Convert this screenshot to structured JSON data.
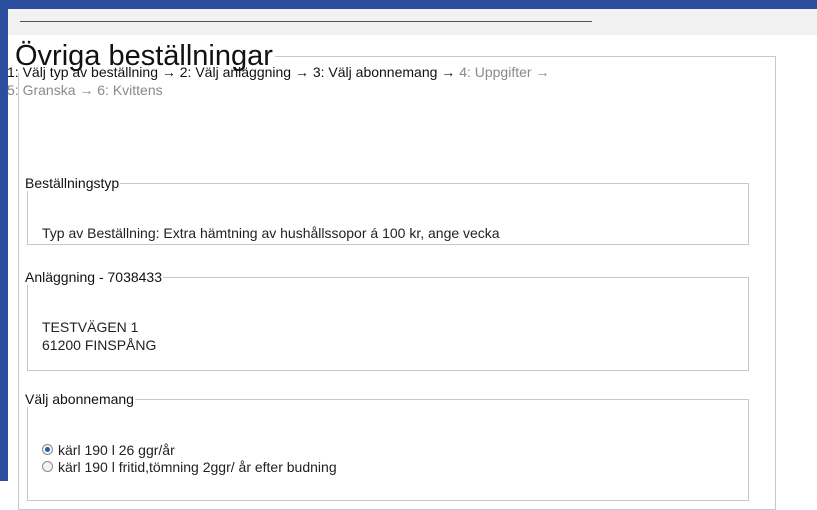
{
  "page": {
    "title": "Övriga beställningar"
  },
  "steps": [
    {
      "label": "1: Välj typ av beställning",
      "arrow": "→",
      "state": "done"
    },
    {
      "label": "2: Välj anläggning",
      "arrow": "→",
      "state": "done"
    },
    {
      "label": "3: Välj abonnemang",
      "arrow": "→",
      "state": "done"
    },
    {
      "label": "4: Uppgifter",
      "arrow": "→",
      "state": "todo"
    },
    {
      "label": "5: Granska",
      "arrow": "→",
      "state": "todo"
    },
    {
      "label": "6: Kvittens",
      "arrow": "",
      "state": "todo"
    }
  ],
  "order_type": {
    "legend": "Beställningstyp",
    "text": "Typ av Beställning: Extra hämtning av hushållssopor á 100 kr, ange vecka"
  },
  "facility": {
    "legend": "Anläggning - 7038433",
    "address_line1": "TESTVÄGEN 1",
    "address_line2": "61200 FINSPÅNG"
  },
  "subscription": {
    "legend": "Välj abonnemang",
    "options": [
      {
        "label": "kärl 190 l 26 ggr/år",
        "selected": true
      },
      {
        "label": "kärl 190 l fritid,tömning 2ggr/ år efter budning",
        "selected": false
      }
    ]
  },
  "colors": {
    "frame": "#2b4f9e",
    "step_done": "#111111",
    "step_todo": "#8a8a8a"
  }
}
